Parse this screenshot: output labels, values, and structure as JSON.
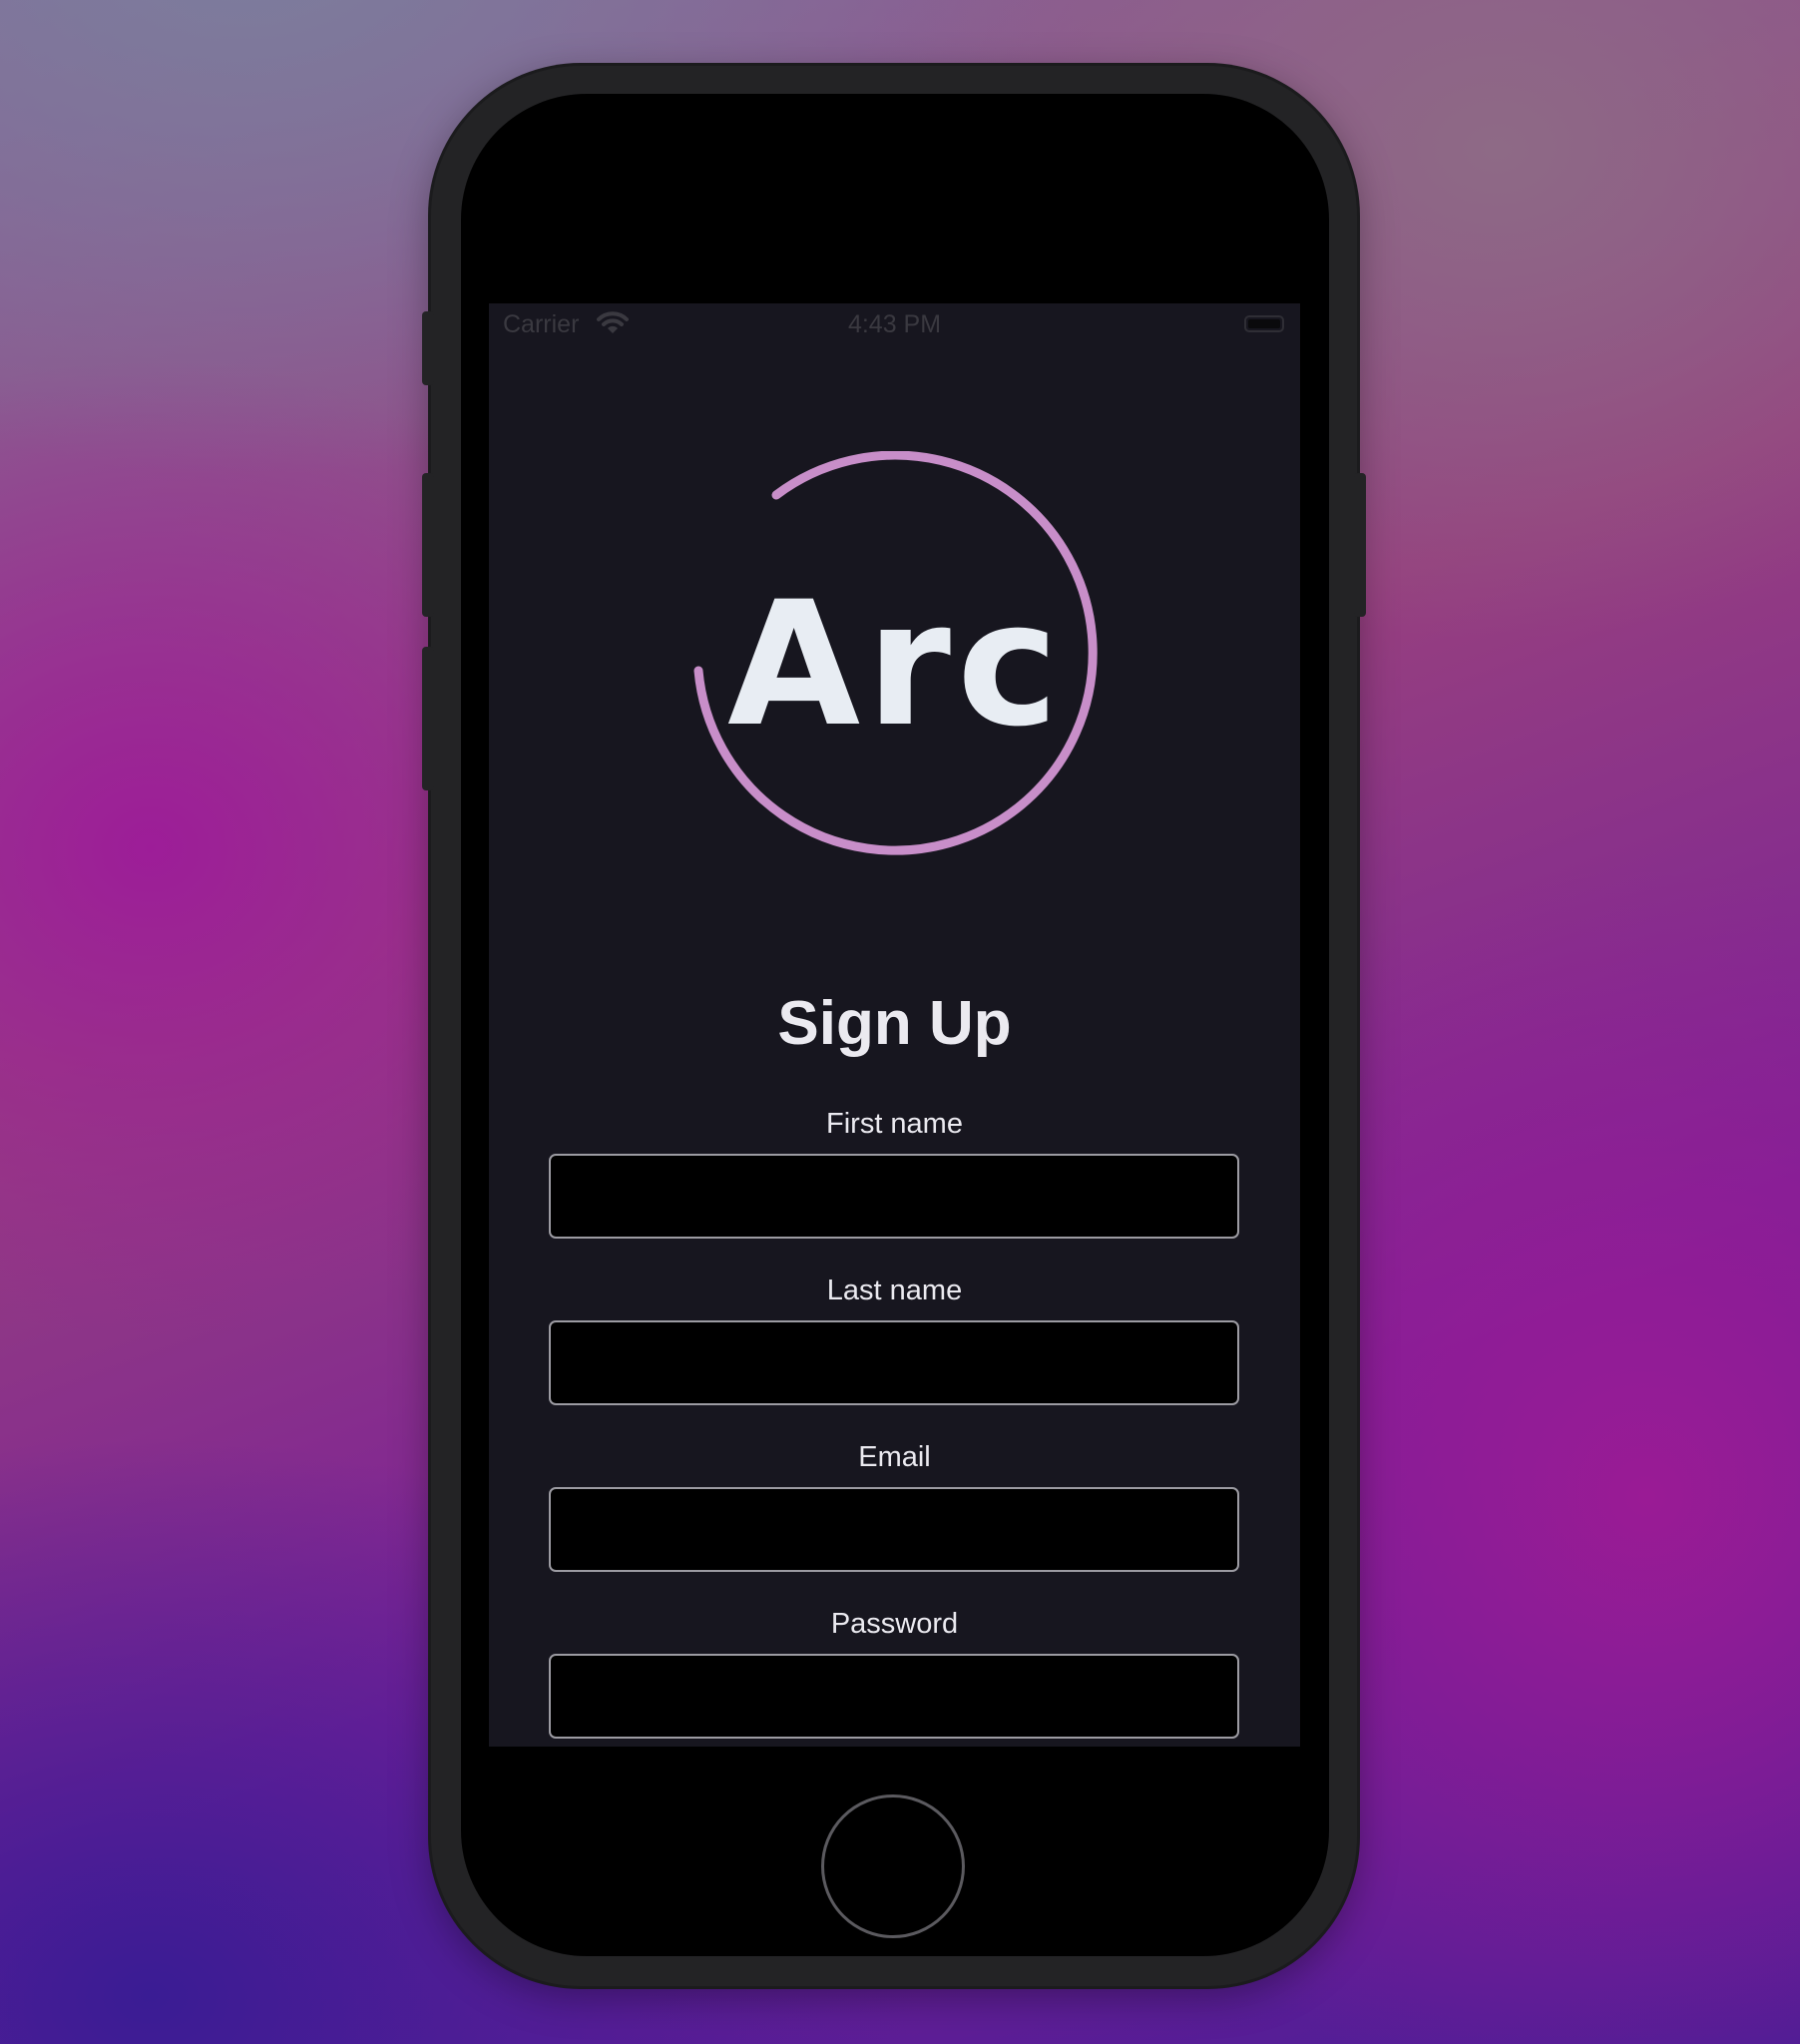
{
  "status_bar": {
    "carrier": "Carrier",
    "time": "4:43 PM",
    "wifi_icon": "wifi-icon",
    "battery_icon": "battery-icon"
  },
  "logo": {
    "text": "Arc",
    "ring_color": "#c88ec9"
  },
  "title": "Sign Up",
  "form": {
    "first_name": {
      "label": "First name",
      "value": ""
    },
    "last_name": {
      "label": "Last name",
      "value": ""
    },
    "email": {
      "label": "Email",
      "value": ""
    },
    "password": {
      "label": "Password",
      "value": ""
    }
  },
  "colors": {
    "screen_background": "#17161f",
    "input_background": "#000000",
    "input_border": "#9c9ba2",
    "text": "#ebeaf0"
  }
}
